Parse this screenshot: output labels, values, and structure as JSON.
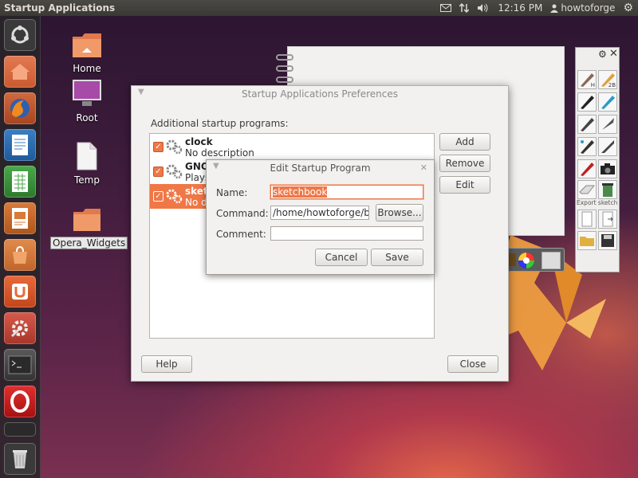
{
  "top_panel": {
    "app_title": "Startup Applications",
    "time": "12:16 PM",
    "user": "howtoforge",
    "indicator_icons": [
      "mail-icon",
      "network-icon",
      "volume-icon",
      "user-icon",
      "gear-icon"
    ]
  },
  "launcher": {
    "items": [
      "ubuntu-logo-icon",
      "home-folder-icon",
      "firefox-icon",
      "writer-icon",
      "calc-icon",
      "impress-icon",
      "software-center-icon",
      "ubuntu-one-icon",
      "system-settings-icon",
      "terminal-icon",
      "opera-icon",
      "workspaces-icon",
      "trash-icon"
    ]
  },
  "desktop": {
    "icons": [
      {
        "label": "Home"
      },
      {
        "label": "Root"
      },
      {
        "label": "Temp"
      },
      {
        "label": "Opera_Widgets"
      }
    ]
  },
  "sketch_palette": {
    "tool_labels": [
      "H",
      "2B"
    ],
    "export_label": "Export sketch"
  },
  "main_dialog": {
    "title": "Startup Applications Preferences",
    "section_label": "Additional startup programs:",
    "programs": [
      {
        "name": "clock",
        "description": "No description",
        "checked": true
      },
      {
        "name": "GNO",
        "description": "Plays",
        "checked": true
      },
      {
        "name": "sketc",
        "description": "No de",
        "checked": true
      }
    ],
    "buttons": {
      "add": "Add",
      "remove": "Remove",
      "edit": "Edit",
      "help": "Help",
      "close": "Close"
    }
  },
  "edit_dialog": {
    "title": "Edit Startup Program",
    "name_label": "Name:",
    "name_value": "sketchbook",
    "command_label": "Command:",
    "command_value": "/home/howtoforge/bin",
    "comment_label": "Comment:",
    "comment_value": "",
    "browse_label": "Browse...",
    "cancel_label": "Cancel",
    "save_label": "Save"
  },
  "colors": {
    "accent": "#f07746",
    "panel": "#3c3b37"
  }
}
